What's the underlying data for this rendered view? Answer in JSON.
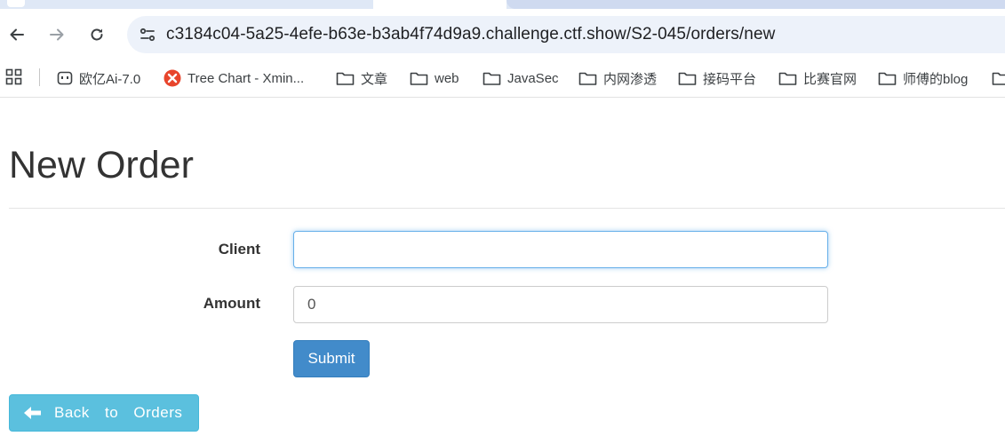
{
  "browser": {
    "url": "c3184c04-5a25-4efe-b63e-b3ab4f74d9a9.challenge.ctf.show/S2-045/orders/new",
    "bookmarks": [
      {
        "label": "欧亿Ai-7.0",
        "icon": "bot-icon"
      },
      {
        "label": "Tree Chart - Xmin...",
        "icon": "xmind-icon"
      },
      {
        "label": "文章",
        "icon": "folder-icon"
      },
      {
        "label": "web",
        "icon": "folder-icon"
      },
      {
        "label": "JavaSec",
        "icon": "folder-icon"
      },
      {
        "label": "内网渗透",
        "icon": "folder-icon"
      },
      {
        "label": "接码平台",
        "icon": "folder-icon"
      },
      {
        "label": "比赛官网",
        "icon": "folder-icon"
      },
      {
        "label": "师傅的blog",
        "icon": "folder-icon"
      }
    ]
  },
  "page": {
    "title": "New Order",
    "form": {
      "client_label": "Client",
      "client_value": "",
      "amount_label": "Amount",
      "amount_value": "0",
      "submit_label": "Submit"
    },
    "back_label": "Back to Orders"
  },
  "colors": {
    "primary": "#428bca",
    "info": "#5bc0de",
    "focus": "#66afe9"
  }
}
